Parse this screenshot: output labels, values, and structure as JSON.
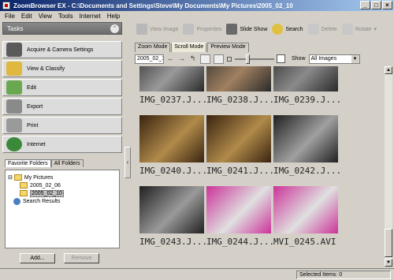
{
  "window": {
    "title": "ZoomBrowser EX - C:\\Documents and Settings\\Steve\\My Documents\\My Pictures\\2005_02_10",
    "min": "_",
    "max": "□",
    "close": "×"
  },
  "menu": [
    "File",
    "Edit",
    "View",
    "Tools",
    "Internet",
    "Help"
  ],
  "tasks": {
    "header": "Tasks",
    "items": [
      {
        "label": "Acquire & Camera Settings",
        "icon": "camera-icon",
        "color": "#5a5a5a"
      },
      {
        "label": "View & Classify",
        "icon": "folder-view-icon",
        "color": "#e0b840"
      },
      {
        "label": "Edit",
        "icon": "edit-icon",
        "color": "#6aa84f"
      },
      {
        "label": "Export",
        "icon": "export-icon",
        "color": "#8a8a8a"
      },
      {
        "label": "Print",
        "icon": "printer-icon",
        "color": "#9a9a9a"
      },
      {
        "label": "Internet",
        "icon": "globe-icon",
        "color": "#3a8a3a"
      }
    ]
  },
  "favorites": {
    "tabs": [
      "Favorite Folders",
      "All Folders"
    ],
    "tree": {
      "root": "My Pictures",
      "children": [
        "2005_02_06",
        "2005_02_10"
      ],
      "search": "Search Results"
    },
    "add_label": "Add...",
    "remove_label": "Remove"
  },
  "toolbar": {
    "view_image": "View Image",
    "properties": "Properties",
    "slide_show": "Slide Show",
    "search": "Search",
    "delete": "Delete",
    "rotate": "Rotate"
  },
  "view_tabs": [
    "Zoom Mode",
    "Scroll Mode",
    "Preview Mode"
  ],
  "viewbar": {
    "date_value": "2005_02_1",
    "show_label": "Show",
    "show_value": "All Images",
    "thumb_size_level": 0.3
  },
  "thumbnails": [
    {
      "label": "IMG_0237.J...",
      "colors": [
        "#2a2a2a",
        "#9a9a9a"
      ]
    },
    {
      "label": "IMG_0238.J...",
      "colors": [
        "#2a2a2a",
        "#a08060"
      ]
    },
    {
      "label": "IMG_0239.J...",
      "colors": [
        "#2a2a2a",
        "#8a8a8a"
      ]
    },
    {
      "label": "IMG_0240.J...",
      "colors": [
        "#3a2410",
        "#b08a4a"
      ]
    },
    {
      "label": "IMG_0241.J...",
      "colors": [
        "#3a2410",
        "#b08a4a"
      ]
    },
    {
      "label": "IMG_0242.J...",
      "colors": [
        "#202020",
        "#a0a0a0"
      ]
    },
    {
      "label": "IMG_0243.J...",
      "colors": [
        "#202020",
        "#9a9a9a"
      ]
    },
    {
      "label": "IMG_0244.J...",
      "colors": [
        "#cc3399",
        "#e0e0e0"
      ]
    },
    {
      "label": "MVI_0245.AVI",
      "colors": [
        "#cc3399",
        "#e0e0e0"
      ]
    }
  ],
  "status": {
    "selected": "Selected Items: 0"
  }
}
